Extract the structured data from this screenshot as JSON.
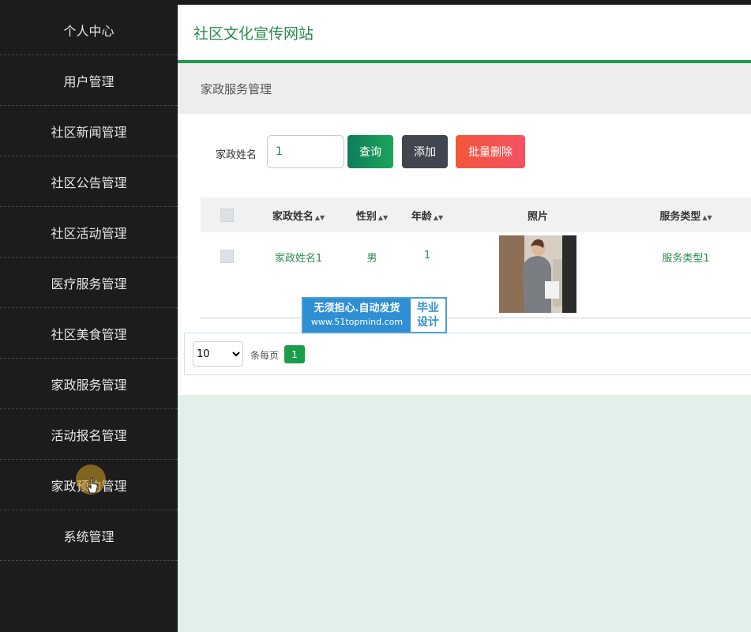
{
  "sidebar": {
    "items": [
      {
        "label": "个人中心"
      },
      {
        "label": "用户管理"
      },
      {
        "label": "社区新闻管理"
      },
      {
        "label": "社区公告管理"
      },
      {
        "label": "社区活动管理"
      },
      {
        "label": "医疗服务管理"
      },
      {
        "label": "社区美食管理"
      },
      {
        "label": "家政服务管理"
      },
      {
        "label": "活动报名管理"
      },
      {
        "label": "家政预约管理"
      },
      {
        "label": "系统管理"
      }
    ]
  },
  "header": {
    "title": "社区文化宣传网站"
  },
  "breadcrumb": {
    "text": "家政服务管理"
  },
  "search": {
    "label": "家政姓名",
    "value": "1"
  },
  "toolbar": {
    "query_label": "查询",
    "add_label": "添加",
    "batch_delete_label": "批量删除"
  },
  "table": {
    "columns": [
      "家政姓名",
      "性别",
      "年龄",
      "照片",
      "服务类型"
    ],
    "rows": [
      {
        "name": "家政姓名1",
        "gender": "男",
        "age": "1",
        "service_type": "服务类型1"
      }
    ]
  },
  "pagination": {
    "page_size": "10",
    "per_page_label": "条每页",
    "current_page": "1"
  },
  "watermark": {
    "line1": "无须担心.自动发货",
    "line2": "www.51topmind.com",
    "right1": "毕业",
    "right2": "设计"
  },
  "colors": {
    "accent": "#1f9a4e",
    "sidebar_bg": "#1c1c1c",
    "add_btn": "#414651",
    "delete_btn": "#f2563a"
  }
}
